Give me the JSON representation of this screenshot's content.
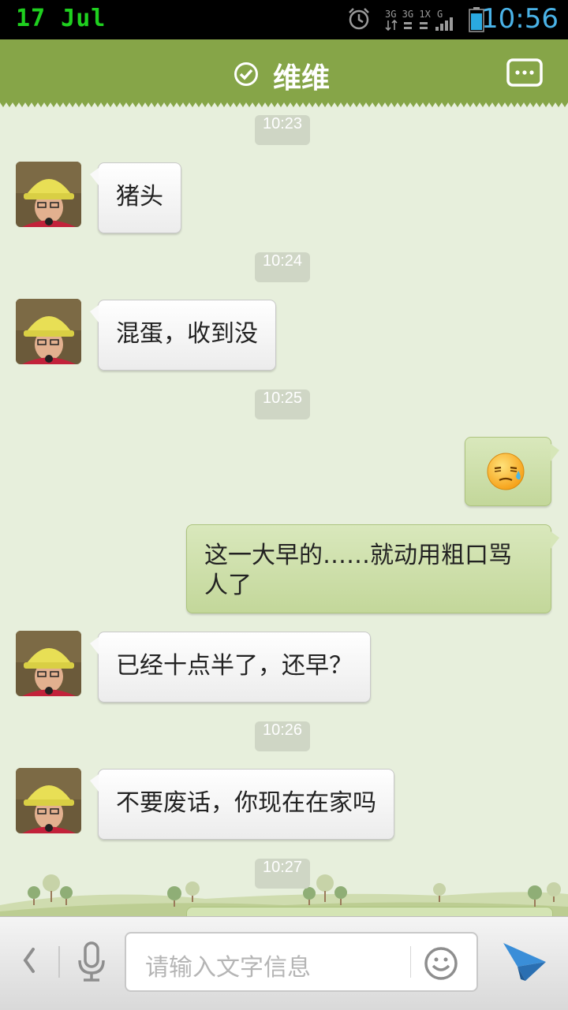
{
  "status_bar": {
    "date": "17 Jul",
    "time": "10:56",
    "icons": [
      "alarm-icon",
      "network-3g-icon",
      "signal-icon",
      "battery-icon"
    ],
    "colors": {
      "date": "#1fd01f",
      "time": "#4ab3e8"
    }
  },
  "header": {
    "contact_name": "维维",
    "verified_icon": "check-circle-icon",
    "menu_icon": "chat-menu-icon",
    "bg_color": "#86a548"
  },
  "chat": {
    "timestamps": [
      "10:23",
      "10:24",
      "10:25",
      "10:26",
      "10:27"
    ],
    "messages": [
      {
        "from": "contact",
        "text": "猪头"
      },
      {
        "from": "contact",
        "text": "混蛋，收到没"
      },
      {
        "from": "me",
        "type": "emoji",
        "emoji": "sweat-annoyed-emoji"
      },
      {
        "from": "me",
        "text": "这一大早的……就动用粗口骂人了"
      },
      {
        "from": "contact",
        "text": "已经十点半了，还早？"
      },
      {
        "from": "contact",
        "text": "不要废话，你现在在家吗"
      }
    ]
  },
  "input": {
    "placeholder": "请输入文字信息",
    "icons": [
      "back-chevron-icon",
      "microphone-icon",
      "smiley-icon",
      "send-icon"
    ]
  }
}
